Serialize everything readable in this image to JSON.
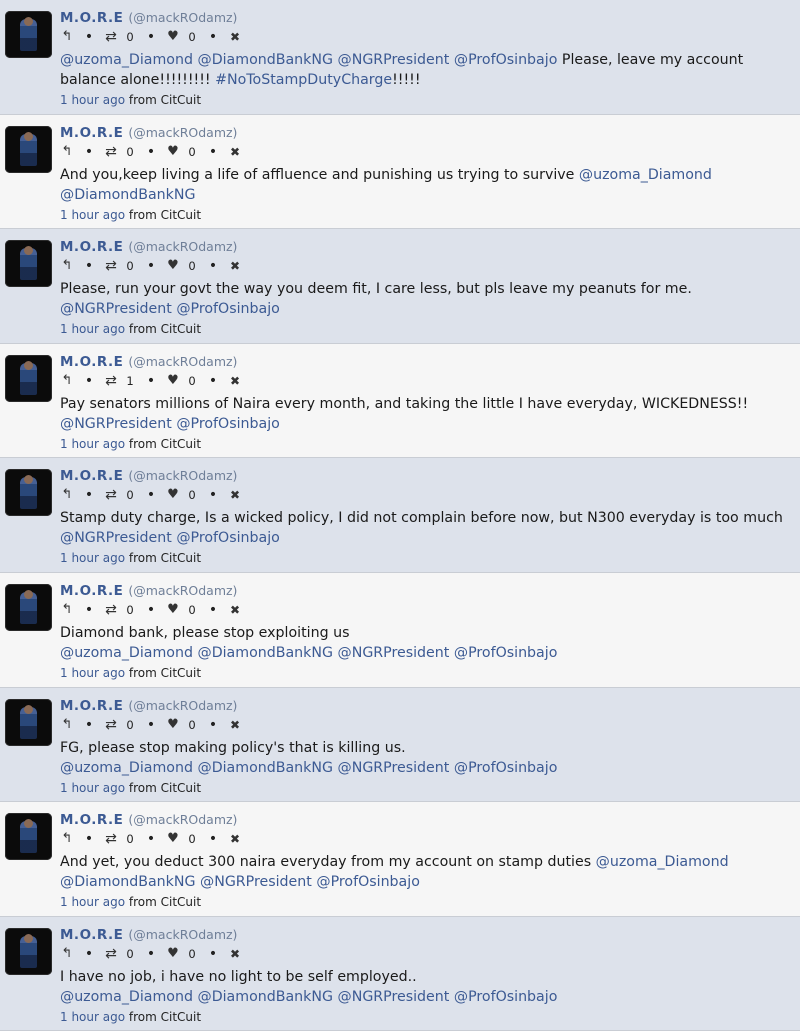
{
  "tweets": [
    {
      "name": "M.O.R.E",
      "handle": "(@mackROdamz)",
      "retweets": "0",
      "likes": "0",
      "segments": [
        {
          "t": "@uzoma_Diamond",
          "link": true
        },
        {
          "t": " ",
          "link": false
        },
        {
          "t": "@DiamondBankNG",
          "link": true
        },
        {
          "t": " ",
          "link": false
        },
        {
          "t": "@NGRPresident",
          "link": true
        },
        {
          "t": " ",
          "link": false
        },
        {
          "t": "@ProfOsinbajo",
          "link": true
        },
        {
          "t": " Please, leave my account balance alone!!!!!!!!! ",
          "link": false
        },
        {
          "t": "#NoToStampDutyCharge",
          "link": true
        },
        {
          "t": "!!!!!",
          "link": false
        }
      ],
      "time": "1 hour ago",
      "source": "from CitCuit"
    },
    {
      "name": "M.O.R.E",
      "handle": "(@mackROdamz)",
      "retweets": "0",
      "likes": "0",
      "segments": [
        {
          "t": "And you,keep living a life of affluence and punishing us trying to survive ",
          "link": false
        },
        {
          "t": "@uzoma_Diamond",
          "link": true
        },
        {
          "t": " ",
          "link": false
        },
        {
          "t": "@DiamondBankNG",
          "link": true
        }
      ],
      "time": "1 hour ago",
      "source": "from CitCuit"
    },
    {
      "name": "M.O.R.E",
      "handle": "(@mackROdamz)",
      "retweets": "0",
      "likes": "0",
      "segments": [
        {
          "t": "Please, run your govt the way you deem fit, I care less, but pls leave my peanuts for me. ",
          "link": false
        },
        {
          "t": "@NGRPresident",
          "link": true
        },
        {
          "t": " ",
          "link": false
        },
        {
          "t": "@ProfOsinbajo",
          "link": true
        }
      ],
      "time": "1 hour ago",
      "source": "from CitCuit"
    },
    {
      "name": "M.O.R.E",
      "handle": "(@mackROdamz)",
      "retweets": "1",
      "likes": "0",
      "segments": [
        {
          "t": "Pay senators millions of Naira every month, and taking the little I have everyday, WICKEDNESS!! ",
          "link": false
        },
        {
          "t": "@NGRPresident",
          "link": true
        },
        {
          "t": " ",
          "link": false
        },
        {
          "t": "@ProfOsinbajo",
          "link": true
        }
      ],
      "time": "1 hour ago",
      "source": "from CitCuit"
    },
    {
      "name": "M.O.R.E",
      "handle": "(@mackROdamz)",
      "retweets": "0",
      "likes": "0",
      "segments": [
        {
          "t": "Stamp duty charge, Is a wicked policy, I did not complain before now, but N300 everyday is too much ",
          "link": false
        },
        {
          "t": "@NGRPresident",
          "link": true
        },
        {
          "t": " ",
          "link": false
        },
        {
          "t": "@ProfOsinbajo",
          "link": true
        }
      ],
      "time": "1 hour ago",
      "source": "from CitCuit"
    },
    {
      "name": "M.O.R.E",
      "handle": "(@mackROdamz)",
      "retweets": "0",
      "likes": "0",
      "segments": [
        {
          "t": "Diamond bank, please stop exploiting us\n",
          "link": false
        },
        {
          "t": "@uzoma_Diamond",
          "link": true
        },
        {
          "t": " ",
          "link": false
        },
        {
          "t": "@DiamondBankNG",
          "link": true
        },
        {
          "t": " ",
          "link": false
        },
        {
          "t": "@NGRPresident",
          "link": true
        },
        {
          "t": " ",
          "link": false
        },
        {
          "t": "@ProfOsinbajo",
          "link": true
        }
      ],
      "time": "1 hour ago",
      "source": "from CitCuit"
    },
    {
      "name": "M.O.R.E",
      "handle": "(@mackROdamz)",
      "retweets": "0",
      "likes": "0",
      "segments": [
        {
          "t": "FG, please stop making policy's that is killing us.\n",
          "link": false
        },
        {
          "t": "@uzoma_Diamond",
          "link": true
        },
        {
          "t": " ",
          "link": false
        },
        {
          "t": "@DiamondBankNG",
          "link": true
        },
        {
          "t": " ",
          "link": false
        },
        {
          "t": "@NGRPresident",
          "link": true
        },
        {
          "t": " ",
          "link": false
        },
        {
          "t": "@ProfOsinbajo",
          "link": true
        }
      ],
      "time": "1 hour ago",
      "source": "from CitCuit"
    },
    {
      "name": "M.O.R.E",
      "handle": "(@mackROdamz)",
      "retweets": "0",
      "likes": "0",
      "segments": [
        {
          "t": "And yet, you deduct 300 naira everyday from my account on stamp duties ",
          "link": false
        },
        {
          "t": "@uzoma_Diamond",
          "link": true
        },
        {
          "t": " ",
          "link": false
        },
        {
          "t": "@DiamondBankNG",
          "link": true
        },
        {
          "t": " ",
          "link": false
        },
        {
          "t": "@NGRPresident",
          "link": true
        },
        {
          "t": " ",
          "link": false
        },
        {
          "t": "@ProfOsinbajo",
          "link": true
        }
      ],
      "time": "1 hour ago",
      "source": "from CitCuit"
    },
    {
      "name": "M.O.R.E",
      "handle": "(@mackROdamz)",
      "retweets": "0",
      "likes": "0",
      "segments": [
        {
          "t": "I have no job, i have no light to be self employed..\n",
          "link": false
        },
        {
          "t": "@uzoma_Diamond",
          "link": true
        },
        {
          "t": " ",
          "link": false
        },
        {
          "t": "@DiamondBankNG",
          "link": true
        },
        {
          "t": " ",
          "link": false
        },
        {
          "t": "@NGRPresident",
          "link": true
        },
        {
          "t": " ",
          "link": false
        },
        {
          "t": "@ProfOsinbajo",
          "link": true
        }
      ],
      "time": "1 hour ago",
      "source": "from CitCuit"
    }
  ],
  "icons": {
    "reply": "reply-icon",
    "retweet": "retweet-icon",
    "like": "heart-icon",
    "delete": "close-icon",
    "separator": "•"
  },
  "colors": {
    "row_odd": "#dde2eb",
    "row_even": "#f6f6f6",
    "link": "#3c5a93",
    "handle": "#6f7f98"
  }
}
